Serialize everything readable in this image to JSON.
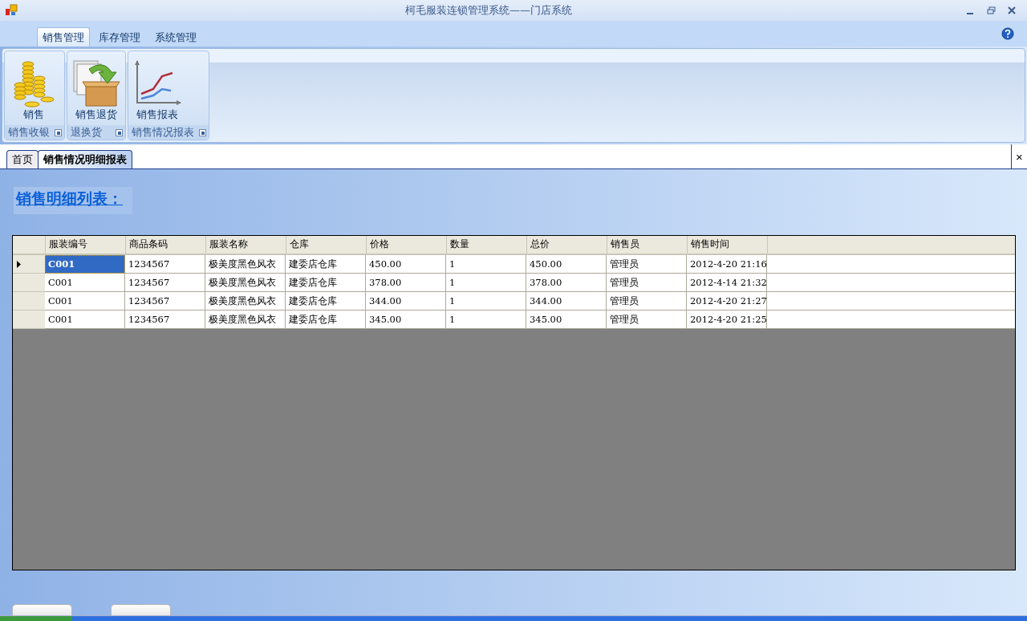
{
  "window": {
    "title": "柯毛服装连锁管理系统——门店系统"
  },
  "ribbon": {
    "tabs": [
      {
        "label": "销售管理",
        "selected": true
      },
      {
        "label": "库存管理",
        "selected": false
      },
      {
        "label": "系统管理",
        "selected": false
      }
    ],
    "groups": [
      {
        "caption": "销售收银",
        "buttons": [
          {
            "label": "销售",
            "kind": "coins"
          }
        ]
      },
      {
        "caption": "退换货",
        "buttons": [
          {
            "label": "销售退货",
            "kind": "return"
          }
        ]
      },
      {
        "caption": "销售情况报表",
        "buttons": [
          {
            "label": "销售报表",
            "kind": "chart"
          }
        ]
      }
    ]
  },
  "doc_tabs": [
    {
      "label": "首页",
      "selected": false
    },
    {
      "label": "销售情况明细报表",
      "selected": true
    }
  ],
  "doc_close": "×",
  "heading": "销售明细列表：",
  "table": {
    "columns": [
      "服装编号",
      "商品条码",
      "服装名称",
      "仓库",
      "价格",
      "数量",
      "总价",
      "销售员",
      "销售时间"
    ],
    "rows": [
      {
        "selected": true,
        "cells": [
          "C001",
          "1234567",
          "极美度黑色风衣",
          "建委店仓库",
          "450.00",
          "1",
          "450.00",
          "管理员",
          "2012-4-20 21:16"
        ]
      },
      {
        "selected": false,
        "cells": [
          "C001",
          "1234567",
          "极美度黑色风衣",
          "建委店仓库",
          "378.00",
          "1",
          "378.00",
          "管理员",
          "2012-4-14 21:32"
        ]
      },
      {
        "selected": false,
        "cells": [
          "C001",
          "1234567",
          "极美度黑色风衣",
          "建委店仓库",
          "344.00",
          "1",
          "344.00",
          "管理员",
          "2012-4-20 21:27"
        ]
      },
      {
        "selected": false,
        "cells": [
          "C001",
          "1234567",
          "极美度黑色风衣",
          "建委店仓库",
          "345.00",
          "1",
          "345.00",
          "管理员",
          "2012-4-20 21:25"
        ]
      }
    ]
  }
}
